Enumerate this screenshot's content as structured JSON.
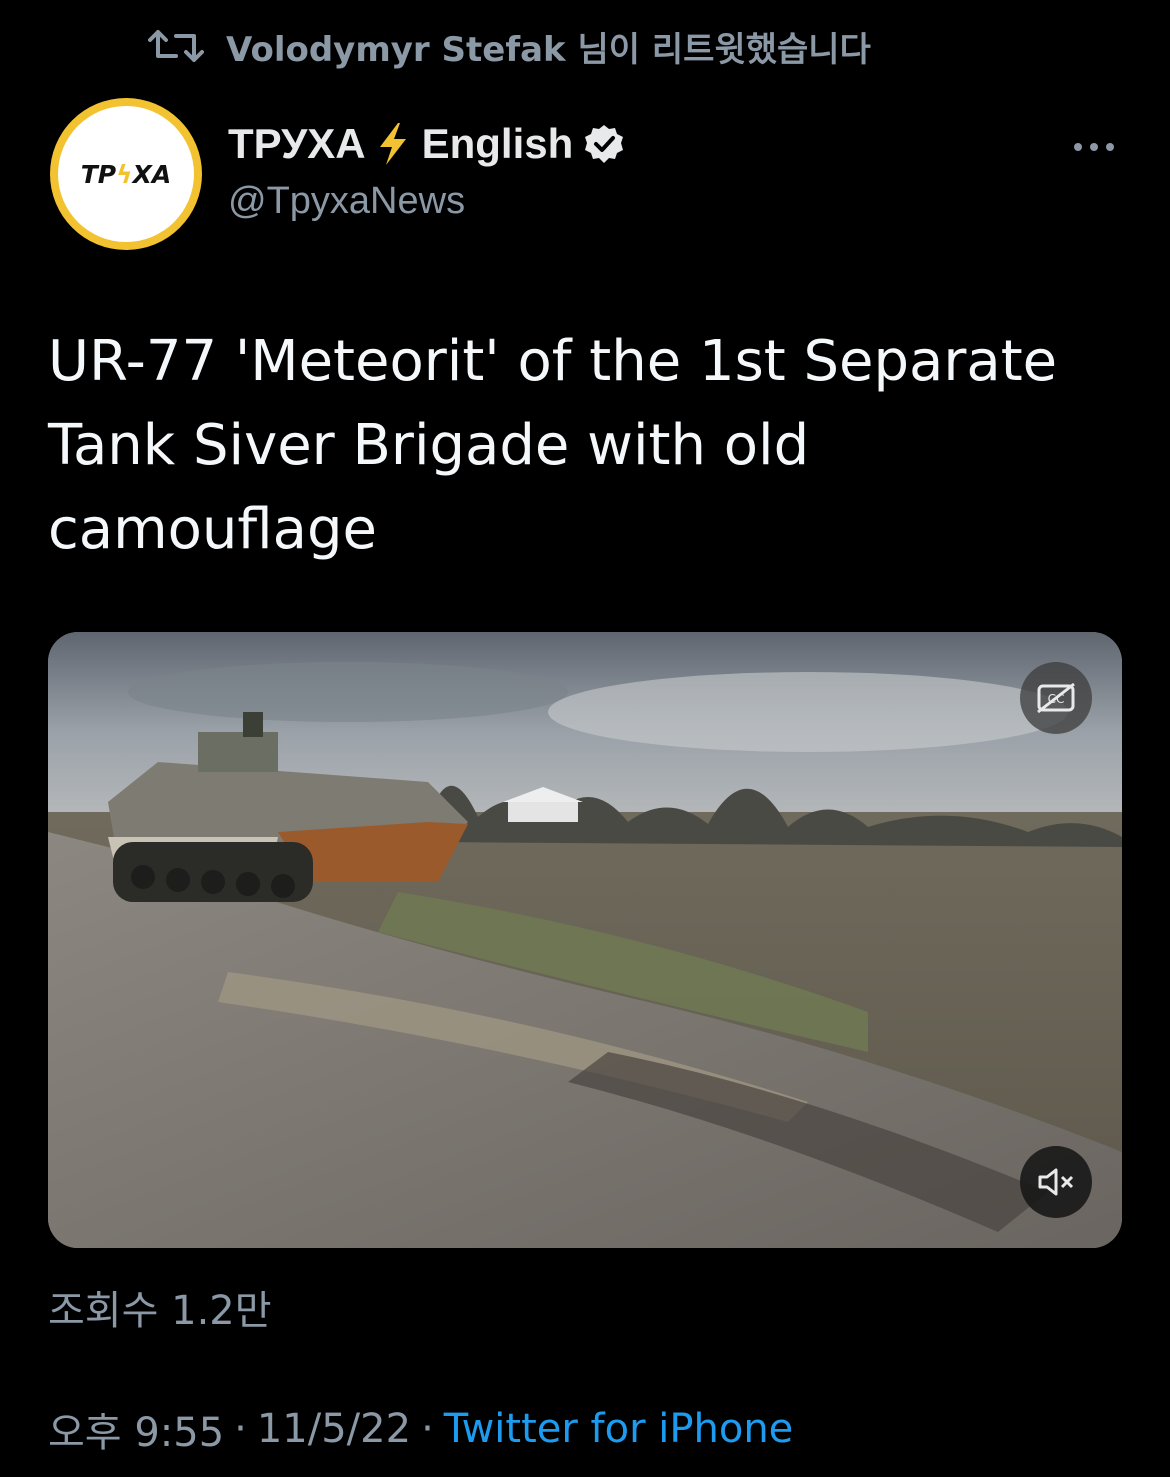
{
  "retweet": {
    "icon": "retweet-icon",
    "text": "Volodymyr Stefak 님이 리트윗했습니다"
  },
  "author": {
    "avatar_text_left": "TP",
    "avatar_text_right": "XA",
    "name_left": "ТРУХА",
    "name_right": "English",
    "bolt_icon": "lightning-icon",
    "verified_icon": "verified-badge-icon",
    "handle": "@TpyxaNews",
    "avatar_colors": {
      "ring": "#f2c230",
      "inner": "#ffffff"
    }
  },
  "more_icon": "more-options-icon",
  "tweet": {
    "text": "UR-77 'Meteorit' of the 1st Separate Tank Siver Brigade with old camouflage"
  },
  "media": {
    "type": "video",
    "cc_icon": "captions-off-icon",
    "mute_icon": "muted-speaker-icon"
  },
  "stats": {
    "views": "조회수 1.2만"
  },
  "meta": {
    "time": "오후 9:55",
    "separator": "·",
    "date": "11/5/22",
    "source": "Twitter for iPhone"
  },
  "colors": {
    "background": "#000000",
    "text_primary": "#e7e9ea",
    "text_secondary": "#8b98a5",
    "link": "#1d9bf0"
  }
}
